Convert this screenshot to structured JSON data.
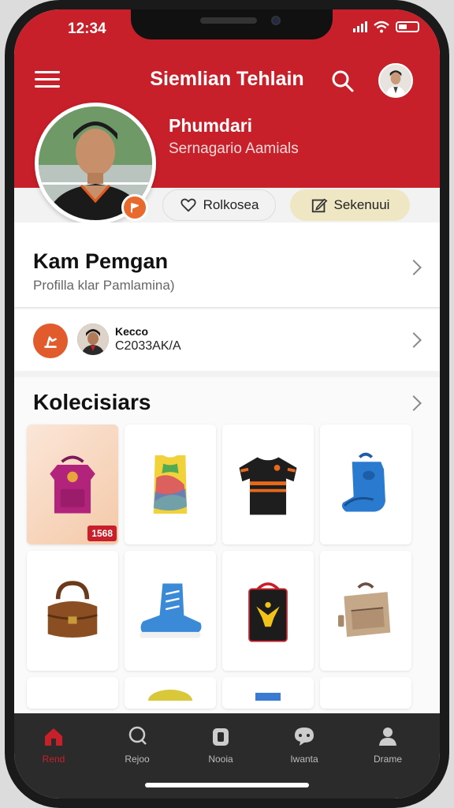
{
  "status": {
    "time": "12:34"
  },
  "header": {
    "title": "Siemlian Tehlain"
  },
  "profile": {
    "name": "Phumdari",
    "subtitle": "Sernagario Aamials"
  },
  "actions": {
    "follow_label": "Rolkosea",
    "edit_label": "Sekenuui"
  },
  "section_profile": {
    "title": "Kam Pemgan",
    "subtitle": "Profilla klar Pamlamina)"
  },
  "section_contact": {
    "name": "Kecco",
    "code": "C2033AK/A"
  },
  "collections": {
    "title": "Kolecisiars",
    "items": [
      {
        "name": "magenta-backpack-item",
        "price": "1568"
      },
      {
        "name": "yellow-jersey-item"
      },
      {
        "name": "black-jersey-item"
      },
      {
        "name": "blue-backpack-item"
      },
      {
        "name": "leather-bag-item"
      },
      {
        "name": "blue-sneaker-item"
      },
      {
        "name": "black-eagle-bag-item"
      },
      {
        "name": "tan-backpack-item"
      }
    ]
  },
  "tabs": [
    {
      "label": "Rend",
      "icon": "home-icon",
      "active": true
    },
    {
      "label": "Rejoo",
      "icon": "chat-icon",
      "active": false
    },
    {
      "label": "Nooia",
      "icon": "shield-icon",
      "active": false
    },
    {
      "label": "Iwanta",
      "icon": "message-icon",
      "active": false
    },
    {
      "label": "Drame",
      "icon": "person-icon",
      "active": false
    }
  ],
  "colors": {
    "brand_red": "#c8202a",
    "accent_orange": "#e25b2c",
    "tab_bar": "#2b2b2b"
  }
}
